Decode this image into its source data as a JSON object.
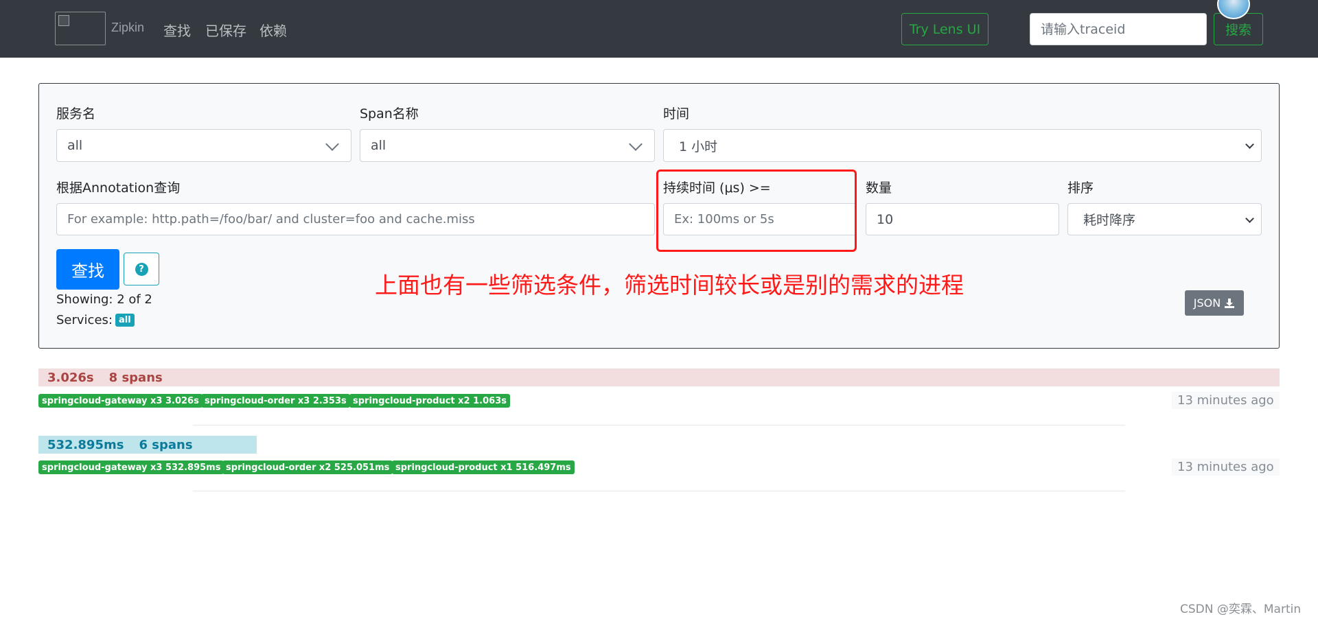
{
  "navbar": {
    "brand": "Zipkin",
    "links": [
      "查找",
      "已保存",
      "依赖"
    ],
    "lens_button": "Try Lens UI",
    "traceid_placeholder": "请输入traceid",
    "search_button": "搜索"
  },
  "filters": {
    "service_label": "服务名",
    "service_value": "all",
    "span_label": "Span名称",
    "span_value": "all",
    "time_label": "时间",
    "time_value": "1 小时",
    "annotation_label": "根据Annotation查询",
    "annotation_placeholder": "For example: http.path=/foo/bar/ and cluster=foo and cache.miss",
    "duration_label": "持续时间 (μs) >=",
    "duration_placeholder": "Ex: 100ms or 5s",
    "limit_label": "数量",
    "limit_value": "10",
    "sort_label": "排序",
    "sort_value": "耗时降序",
    "find_button": "查找",
    "help_icon_glyph": "?",
    "showing": "Showing: 2 of 2",
    "services_label": "Services:",
    "services_badge": "all",
    "json_button": "JSON"
  },
  "annotation_text": "上面也有一些筛选条件，筛选时间较长或是别的需求的进程",
  "traces": [
    {
      "duration": "3.026s",
      "spans": "8 spans",
      "bar_fraction": 1.0,
      "bar_color": "#f2dede",
      "text_color": "#a94442",
      "tags": [
        "springcloud-gateway x3 3.026s",
        "springcloud-order x3 2.353s",
        "springcloud-product x2 1.063s"
      ],
      "ago": "13 minutes ago"
    },
    {
      "duration": "532.895ms",
      "spans": "6 spans",
      "bar_fraction": 0.176,
      "bar_color": "#bee5eb",
      "text_color": "#0c7a9a",
      "tags": [
        "springcloud-gateway x3 532.895ms",
        "springcloud-order x2 525.051ms",
        "springcloud-product x1 516.497ms"
      ],
      "ago": "13 minutes ago"
    }
  ],
  "watermark": "CSDN @奕霖、Martin",
  "colors": {
    "navbar": "#343a40",
    "accent_green": "#28a745",
    "primary": "#007bff",
    "info": "#17a2b8",
    "highlight_red": "#ff1a1a"
  }
}
